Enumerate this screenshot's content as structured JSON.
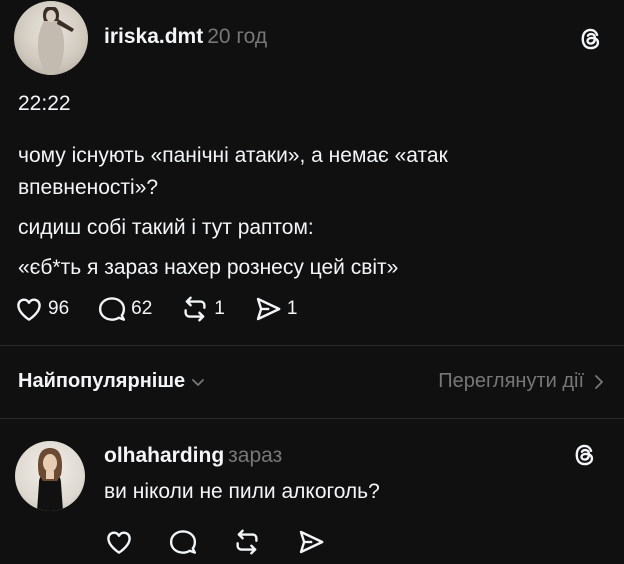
{
  "post": {
    "username": "iriska.dmt",
    "age": "20 год",
    "time": "22:22",
    "text_lines": [
      "чому існують «панічні атаки», а немає «атак",
      "впевненості»?",
      "сидиш собі такий і тут раптом:",
      "«єб*ть я зараз нахер рознесу цей світ»"
    ],
    "likes": "96",
    "comments": "62",
    "reposts": "1",
    "shares": "1"
  },
  "sort": {
    "label": "Найпопулярніше",
    "view_activity": "Переглянути дії"
  },
  "reply": {
    "username": "olhaharding",
    "age": "зараз",
    "text": "ви ніколи не пили алкоголь?"
  },
  "icons": {
    "app_logo": "threads-logo-icon",
    "like": "heart-icon",
    "comment": "comment-bubble-icon",
    "repost": "repost-icon",
    "share": "send-icon",
    "dropdown": "chevron-down-icon",
    "more": "chevron-right-icon"
  },
  "colors": {
    "background": "#101010",
    "text_primary": "#f3f5f7",
    "text_secondary": "#777777",
    "divider": "#2c2c2c"
  }
}
